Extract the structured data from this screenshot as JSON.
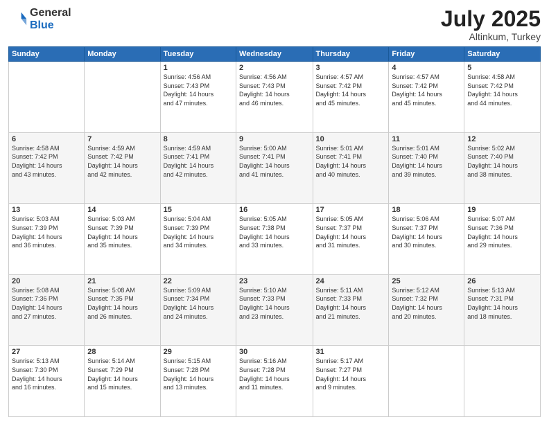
{
  "logo": {
    "general": "General",
    "blue": "Blue"
  },
  "title": "July 2025",
  "subtitle": "Altinkum, Turkey",
  "days_of_week": [
    "Sunday",
    "Monday",
    "Tuesday",
    "Wednesday",
    "Thursday",
    "Friday",
    "Saturday"
  ],
  "weeks": [
    [
      {
        "day": "",
        "info": ""
      },
      {
        "day": "",
        "info": ""
      },
      {
        "day": "1",
        "info": "Sunrise: 4:56 AM\nSunset: 7:43 PM\nDaylight: 14 hours\nand 47 minutes."
      },
      {
        "day": "2",
        "info": "Sunrise: 4:56 AM\nSunset: 7:43 PM\nDaylight: 14 hours\nand 46 minutes."
      },
      {
        "day": "3",
        "info": "Sunrise: 4:57 AM\nSunset: 7:42 PM\nDaylight: 14 hours\nand 45 minutes."
      },
      {
        "day": "4",
        "info": "Sunrise: 4:57 AM\nSunset: 7:42 PM\nDaylight: 14 hours\nand 45 minutes."
      },
      {
        "day": "5",
        "info": "Sunrise: 4:58 AM\nSunset: 7:42 PM\nDaylight: 14 hours\nand 44 minutes."
      }
    ],
    [
      {
        "day": "6",
        "info": "Sunrise: 4:58 AM\nSunset: 7:42 PM\nDaylight: 14 hours\nand 43 minutes."
      },
      {
        "day": "7",
        "info": "Sunrise: 4:59 AM\nSunset: 7:42 PM\nDaylight: 14 hours\nand 42 minutes."
      },
      {
        "day": "8",
        "info": "Sunrise: 4:59 AM\nSunset: 7:41 PM\nDaylight: 14 hours\nand 42 minutes."
      },
      {
        "day": "9",
        "info": "Sunrise: 5:00 AM\nSunset: 7:41 PM\nDaylight: 14 hours\nand 41 minutes."
      },
      {
        "day": "10",
        "info": "Sunrise: 5:01 AM\nSunset: 7:41 PM\nDaylight: 14 hours\nand 40 minutes."
      },
      {
        "day": "11",
        "info": "Sunrise: 5:01 AM\nSunset: 7:40 PM\nDaylight: 14 hours\nand 39 minutes."
      },
      {
        "day": "12",
        "info": "Sunrise: 5:02 AM\nSunset: 7:40 PM\nDaylight: 14 hours\nand 38 minutes."
      }
    ],
    [
      {
        "day": "13",
        "info": "Sunrise: 5:03 AM\nSunset: 7:39 PM\nDaylight: 14 hours\nand 36 minutes."
      },
      {
        "day": "14",
        "info": "Sunrise: 5:03 AM\nSunset: 7:39 PM\nDaylight: 14 hours\nand 35 minutes."
      },
      {
        "day": "15",
        "info": "Sunrise: 5:04 AM\nSunset: 7:39 PM\nDaylight: 14 hours\nand 34 minutes."
      },
      {
        "day": "16",
        "info": "Sunrise: 5:05 AM\nSunset: 7:38 PM\nDaylight: 14 hours\nand 33 minutes."
      },
      {
        "day": "17",
        "info": "Sunrise: 5:05 AM\nSunset: 7:37 PM\nDaylight: 14 hours\nand 31 minutes."
      },
      {
        "day": "18",
        "info": "Sunrise: 5:06 AM\nSunset: 7:37 PM\nDaylight: 14 hours\nand 30 minutes."
      },
      {
        "day": "19",
        "info": "Sunrise: 5:07 AM\nSunset: 7:36 PM\nDaylight: 14 hours\nand 29 minutes."
      }
    ],
    [
      {
        "day": "20",
        "info": "Sunrise: 5:08 AM\nSunset: 7:36 PM\nDaylight: 14 hours\nand 27 minutes."
      },
      {
        "day": "21",
        "info": "Sunrise: 5:08 AM\nSunset: 7:35 PM\nDaylight: 14 hours\nand 26 minutes."
      },
      {
        "day": "22",
        "info": "Sunrise: 5:09 AM\nSunset: 7:34 PM\nDaylight: 14 hours\nand 24 minutes."
      },
      {
        "day": "23",
        "info": "Sunrise: 5:10 AM\nSunset: 7:33 PM\nDaylight: 14 hours\nand 23 minutes."
      },
      {
        "day": "24",
        "info": "Sunrise: 5:11 AM\nSunset: 7:33 PM\nDaylight: 14 hours\nand 21 minutes."
      },
      {
        "day": "25",
        "info": "Sunrise: 5:12 AM\nSunset: 7:32 PM\nDaylight: 14 hours\nand 20 minutes."
      },
      {
        "day": "26",
        "info": "Sunrise: 5:13 AM\nSunset: 7:31 PM\nDaylight: 14 hours\nand 18 minutes."
      }
    ],
    [
      {
        "day": "27",
        "info": "Sunrise: 5:13 AM\nSunset: 7:30 PM\nDaylight: 14 hours\nand 16 minutes."
      },
      {
        "day": "28",
        "info": "Sunrise: 5:14 AM\nSunset: 7:29 PM\nDaylight: 14 hours\nand 15 minutes."
      },
      {
        "day": "29",
        "info": "Sunrise: 5:15 AM\nSunset: 7:28 PM\nDaylight: 14 hours\nand 13 minutes."
      },
      {
        "day": "30",
        "info": "Sunrise: 5:16 AM\nSunset: 7:28 PM\nDaylight: 14 hours\nand 11 minutes."
      },
      {
        "day": "31",
        "info": "Sunrise: 5:17 AM\nSunset: 7:27 PM\nDaylight: 14 hours\nand 9 minutes."
      },
      {
        "day": "",
        "info": ""
      },
      {
        "day": "",
        "info": ""
      }
    ]
  ]
}
